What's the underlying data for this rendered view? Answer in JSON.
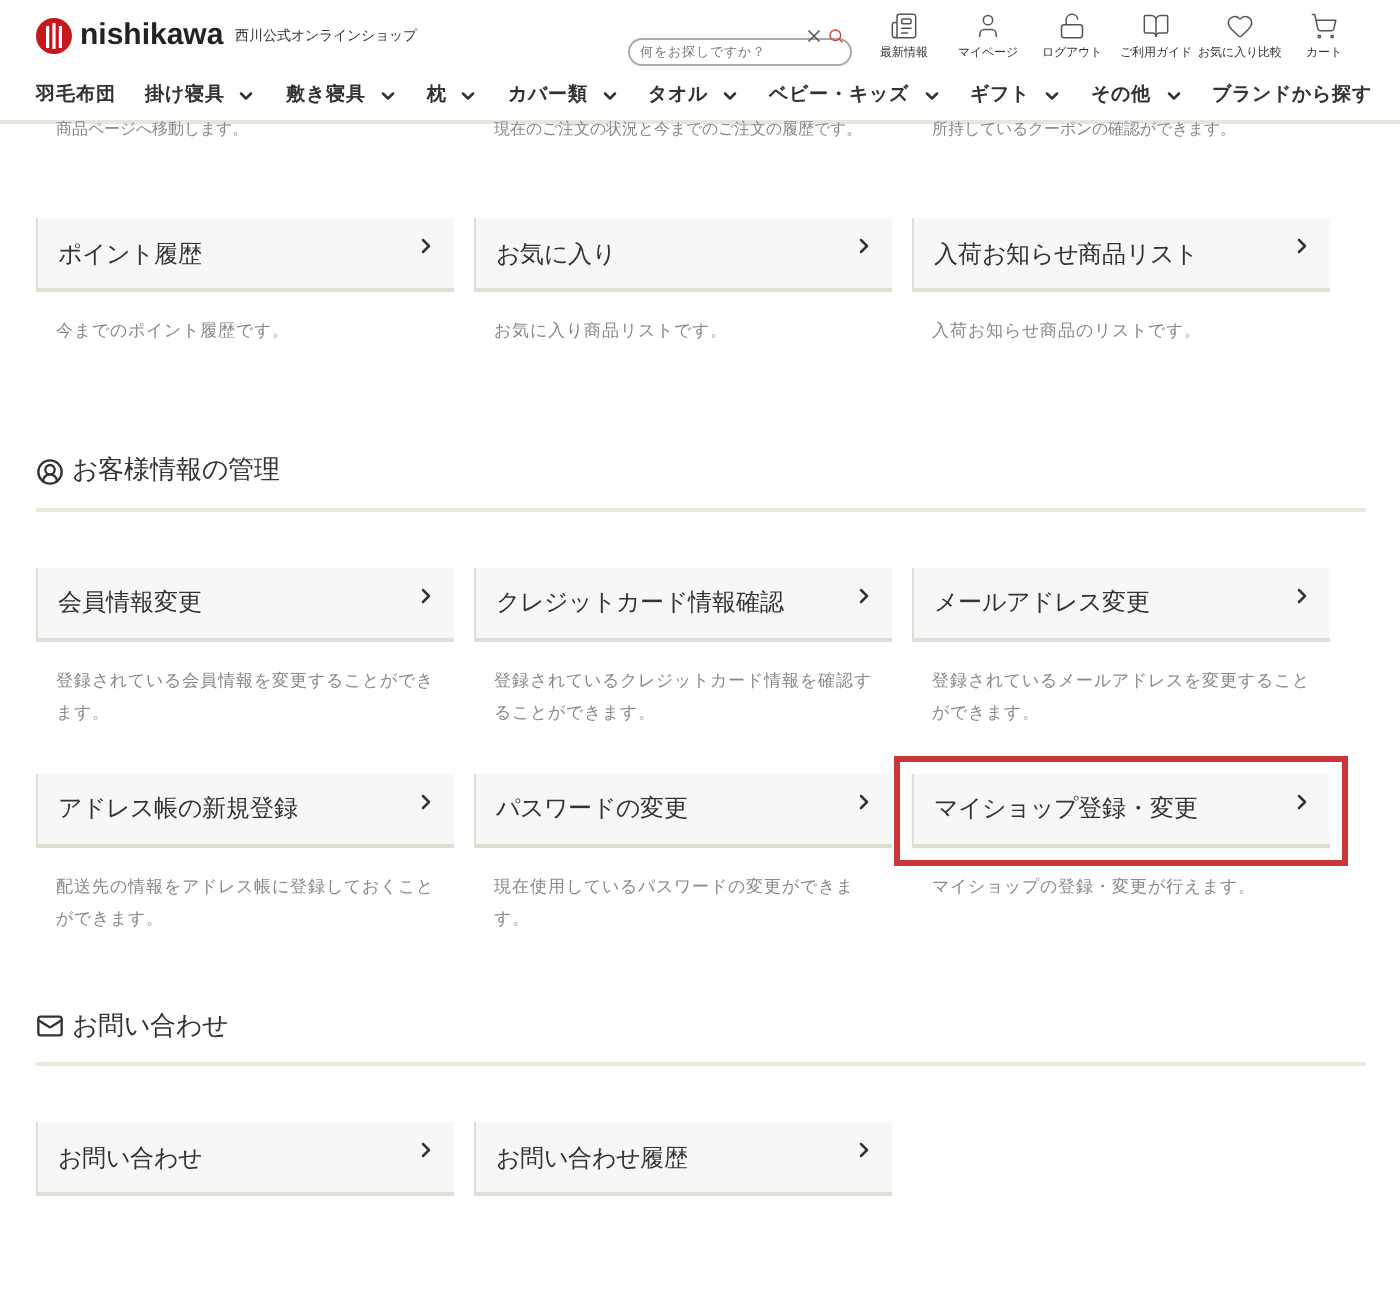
{
  "header": {
    "logo_text": "nishikawa",
    "shop_name": "西川公式オンラインショップ",
    "search": {
      "placeholder": "何をお探しですか？"
    },
    "icons": [
      {
        "kind": "news",
        "label": "最新情報"
      },
      {
        "kind": "user",
        "label": "マイページ"
      },
      {
        "kind": "logout",
        "label": "ログアウト"
      },
      {
        "kind": "guide",
        "label": "ご利用ガイド"
      },
      {
        "kind": "favorite",
        "label": "お気に入り比較"
      },
      {
        "kind": "cart",
        "label": "カート"
      }
    ]
  },
  "nav": [
    {
      "label": "羽毛布団",
      "has_menu": false
    },
    {
      "label": "掛け寝具",
      "has_menu": true
    },
    {
      "label": "敷き寝具",
      "has_menu": true
    },
    {
      "label": "枕",
      "has_menu": true
    },
    {
      "label": "カバー類",
      "has_menu": true
    },
    {
      "label": "タオル",
      "has_menu": true
    },
    {
      "label": "ベビー・キッズ",
      "has_menu": true
    },
    {
      "label": "ギフト",
      "has_menu": true
    },
    {
      "label": "その他",
      "has_menu": true
    },
    {
      "label": "ブランドから探す",
      "has_menu": false
    }
  ],
  "cut_descriptions": [
    "商品ページへ移動します。",
    "現在のご注文の状況と今までのご注文の履歴です。",
    "所持しているクーポンの確認ができます。"
  ],
  "sections": [
    {
      "items": [
        {
          "label": "ポイント履歴",
          "description": "今までのポイント履歴です。",
          "highlighted": false
        },
        {
          "label": "お気に入り",
          "description": "お気に入り商品リストです。",
          "highlighted": false
        },
        {
          "label": "入荷お知らせ商品リスト",
          "description": "入荷お知らせ商品のリストです。",
          "highlighted": false
        }
      ]
    },
    {
      "title": "お客様情報の管理",
      "items": [
        {
          "label": "会員情報変更",
          "description": "登録されている会員情報を変更することができます。",
          "highlighted": false
        },
        {
          "label": "クレジットカード情報確認",
          "description": "登録されているクレジットカード情報を確認することができます。",
          "highlighted": false
        },
        {
          "label": "メールアドレス変更",
          "description": "登録されているメールアドレスを変更することができます。",
          "highlighted": false
        },
        {
          "label": "アドレス帳の新規登録",
          "description": "配送先の情報をアドレス帳に登録しておくことができます。",
          "highlighted": false
        },
        {
          "label": "パスワードの変更",
          "description": "現在使用しているパスワードの変更ができます。",
          "highlighted": false
        },
        {
          "label": "マイショップ登録・変更",
          "description": "マイショップの登録・変更が行えます。",
          "highlighted": true
        }
      ]
    },
    {
      "title": "お問い合わせ",
      "items": [
        {
          "label": "お問い合わせ",
          "highlighted": false
        },
        {
          "label": "お問い合わせ履歴",
          "highlighted": false
        }
      ]
    }
  ]
}
